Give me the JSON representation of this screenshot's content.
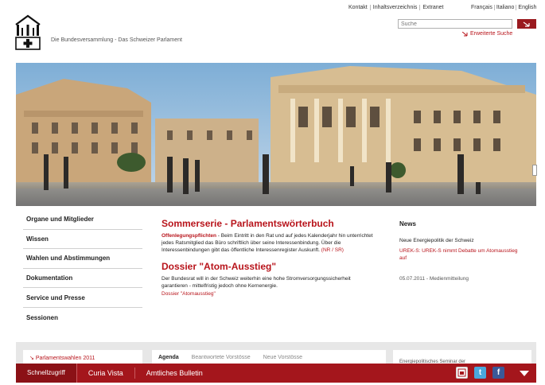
{
  "top_links": [
    "Kontakt",
    "Inhaltsverzeichnis",
    "Extranet"
  ],
  "languages": [
    "Français",
    "Italiano",
    "English"
  ],
  "tagline": "Die Bundesversammlung - Das Schweizer Parlament",
  "search": {
    "placeholder": "Suche",
    "advanced_label": "Erweiterte Suche"
  },
  "hero": {
    "image": "parliament-building-photo"
  },
  "sidenav": {
    "items": [
      "Organe und Mitglieder",
      "Wissen",
      "Wahlen und Abstimmungen",
      "Dokumentation",
      "Service und Presse",
      "Sessionen"
    ]
  },
  "main": {
    "title1": "Sommerserie - Parlamentswörterbuch",
    "link1": "Offenlegungspflichten",
    "text1": " -  Beim Eintritt in den Rat und auf jedes Kalenderjahr hin unterrichtet jedes Ratsmitglied das Büro schriftlich über seine Interessenbindung. Über die Interessenbindungen gibt das öffentliche Interessenregister Auskunft.",
    "link1b": "(NR / SR)",
    "title2": "Dossier \"Atom-Ausstieg\"",
    "text2": "Der Bundesrat will in der Schweiz weiterhin eine hohe Stromversorgungssicherheit garantieren - mittelfristig jedoch ohne Kernenergie.",
    "link2": "Dossier \"Atomausstieg\""
  },
  "news": {
    "title": "News",
    "headline": "Neue Energiepolitik der Schweiz",
    "link": "UREK-S: UREK-S nimmt Debatte um Atomausstieg auf",
    "date": "05.07.2011 - Medienmitteilung"
  },
  "lower": {
    "left_link": "Parlamentswahlen 2011",
    "tabs": [
      "Agenda",
      "Beantwortete Vorstösse",
      "Neue Vorstösse"
    ],
    "right_text": "Energiepolitisches Seminar der"
  },
  "bottombar": {
    "items": [
      "Schnellzugriff",
      "Curia Vista",
      "Amtliches Bulletin"
    ],
    "icons": [
      "info-icon",
      "twitter-icon",
      "facebook-icon"
    ]
  },
  "colors": {
    "accent": "#a4161c",
    "link": "#b8141b"
  }
}
